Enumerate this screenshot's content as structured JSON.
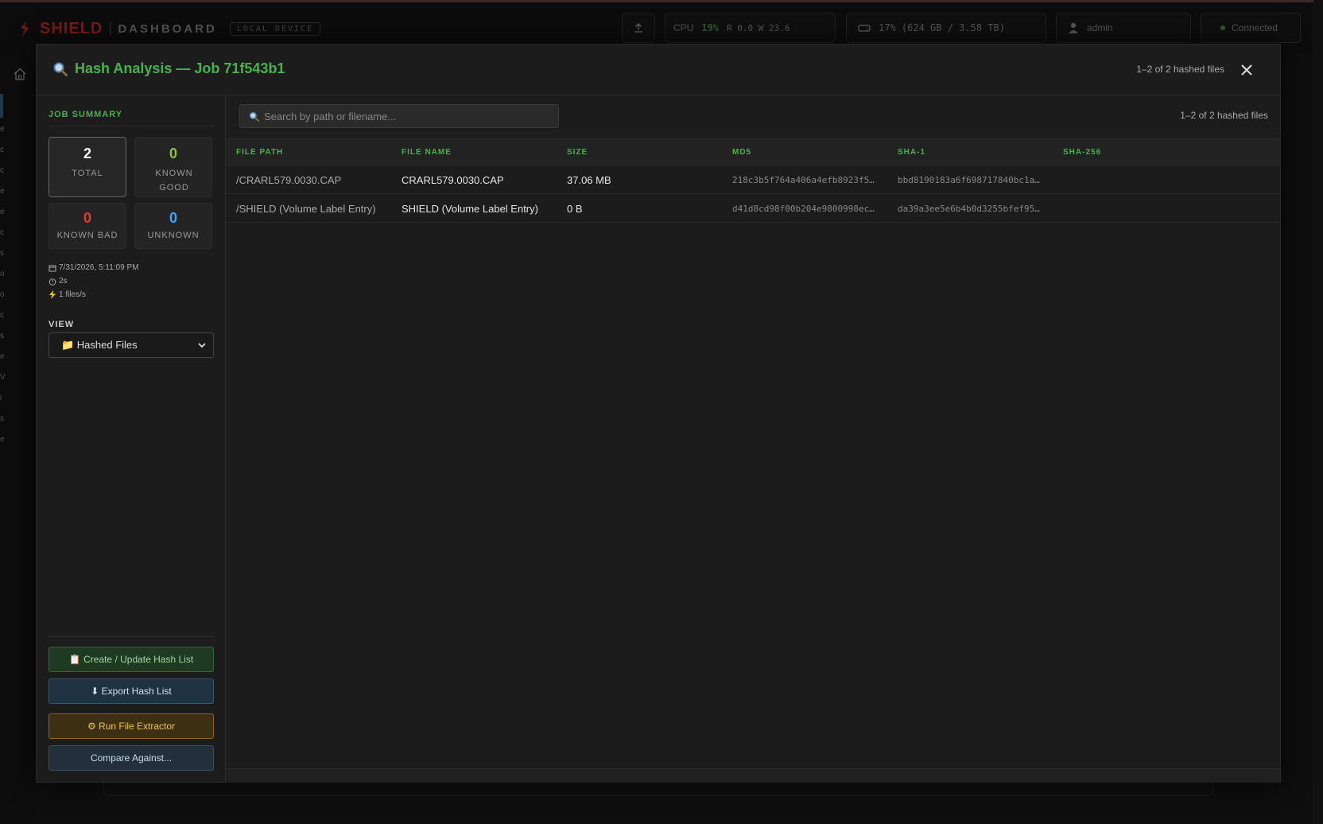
{
  "app": {
    "brand": "SHIELD",
    "section": "DASHBOARD",
    "device_badge": "LOCAL DEVICE",
    "cpu_label": "CPU",
    "cpu_value": "19%",
    "cpu_io": "R 0.0  W 23.6",
    "disk": "17% (624 GB / 3.58 TB)",
    "user": "admin",
    "connection": "Connected",
    "side_letters": [
      "e",
      "c",
      "c",
      "e",
      "e",
      "c",
      "s",
      "o",
      "o",
      "c",
      "s",
      "e",
      "V",
      "i",
      "s",
      "e"
    ]
  },
  "colors": {
    "accent_green": "#4caf50",
    "bad_red": "#e53935",
    "unknown_blue": "#42a5f5",
    "good_green": "#8bc34a"
  },
  "modal": {
    "title": "Hash Analysis — Job 71f543b1",
    "title_icon": "magnifier-icon",
    "header_count": "1–2 of 2 hashed files",
    "close_icon": "close-icon"
  },
  "summary": {
    "title": "JOB SUMMARY",
    "total": {
      "value": "2",
      "label": "TOTAL"
    },
    "known_good": {
      "value": "0",
      "label": "KNOWN GOOD"
    },
    "known_bad": {
      "value": "0",
      "label": "KNOWN BAD"
    },
    "unknown": {
      "value": "0",
      "label": "UNKNOWN"
    },
    "date": "7/31/2026, 5:11:09 PM",
    "duration": "2s",
    "rate": "1 files/s"
  },
  "view": {
    "title": "VIEW",
    "selected": "📁 Hashed Files"
  },
  "actions": {
    "create": "📋 Create / Update Hash List",
    "export": "⬇ Export Hash List",
    "extract": "⚙ Run File Extractor",
    "compare": "Compare Against..."
  },
  "search": {
    "placeholder": "Search by path or filename...",
    "value": ""
  },
  "table": {
    "count": "1–2 of 2 hashed files",
    "columns": [
      "FILE PATH",
      "FILE NAME",
      "SIZE",
      "MD5",
      "SHA-1",
      "SHA-256"
    ],
    "rows": [
      {
        "path": "/CRARL579.0030.CAP",
        "name": "CRARL579.0030.CAP",
        "size": "37.06 MB",
        "md5": "218c3b5f764a406a4efb8923f5…",
        "sha1": "bbd8190183a6f698717840bc1a…",
        "sha256": ""
      },
      {
        "path": "/SHIELD (Volume Label Entry)",
        "name": "SHIELD (Volume Label Entry)",
        "size": "0 B",
        "md5": "d41d8cd98f00b204e9800998ec…",
        "sha1": "da39a3ee5e6b4b0d3255bfef95…",
        "sha256": ""
      }
    ]
  }
}
